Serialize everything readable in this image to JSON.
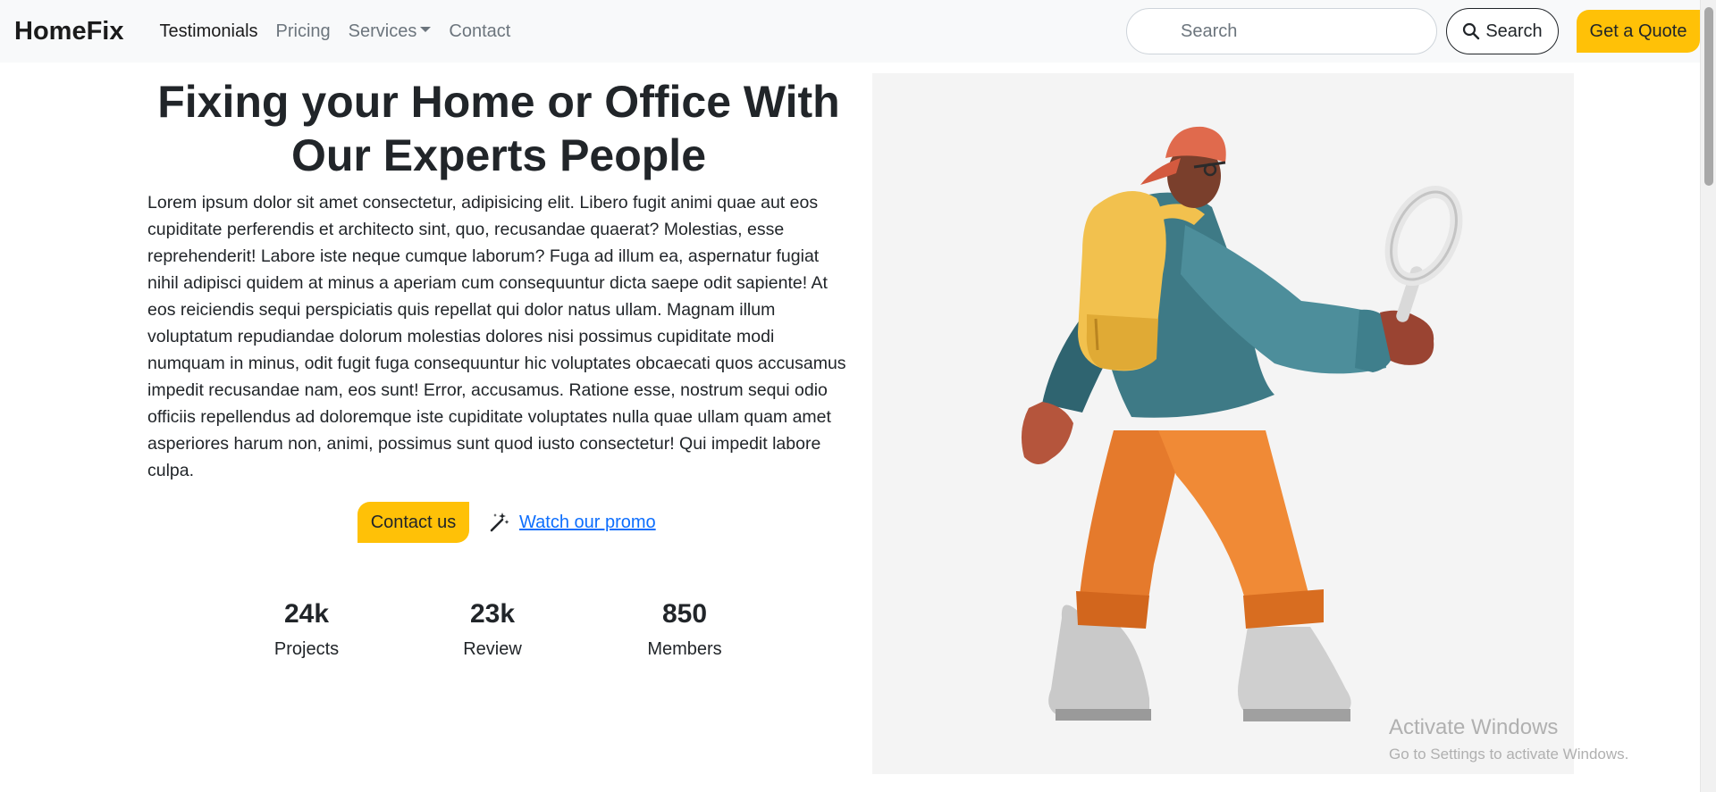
{
  "nav": {
    "brand": "HomeFix",
    "links": [
      "Testimonials",
      "Pricing",
      "Services",
      "Contact"
    ],
    "search_placeholder": "Search",
    "search_button": "Search",
    "quote_button": "Get a Quote"
  },
  "hero": {
    "title_line1": "Fixing your Home or Office With",
    "title_line2": "Our Experts People",
    "paragraph": "Lorem ipsum dolor sit amet consectetur, adipisicing elit. Libero fugit animi quae aut eos cupiditate perferendis et architecto sint, quo, recusandae quaerat? Molestias, esse reprehenderit! Labore iste neque cumque laborum? Fuga ad illum ea, aspernatur fugiat nihil adipisci quidem at minus a aperiam cum consequuntur dicta saepe odit sapiente! At eos reiciendis sequi perspiciatis quis repellat qui dolor natus ullam. Magnam illum voluptatum repudiandae dolorum molestias dolores nisi possimus cupiditate modi numquam in minus, odit fugit fuga consequuntur hic voluptates obcaecati quos accusamus impedit recusandae nam, eos sunt! Error, accusamus. Ratione esse, nostrum sequi odio officiis repellendus ad doloremque iste cupiditate voluptates nulla quae ullam quam amet asperiores harum non, animi, possimus sunt quod iusto consectetur! Qui impedit labore culpa.",
    "contact_button": "Contact us",
    "promo_link": "Watch our promo"
  },
  "stats": [
    {
      "value": "24k",
      "label": "Projects"
    },
    {
      "value": "23k",
      "label": "Review"
    },
    {
      "value": "850",
      "label": "Members"
    }
  ],
  "watermark": {
    "title": "Activate Windows",
    "subtitle": "Go to Settings to activate Windows."
  },
  "colors": {
    "accent": "#ffc107",
    "link": "#0d6efd",
    "navbar_bg": "#f8f9fa"
  }
}
